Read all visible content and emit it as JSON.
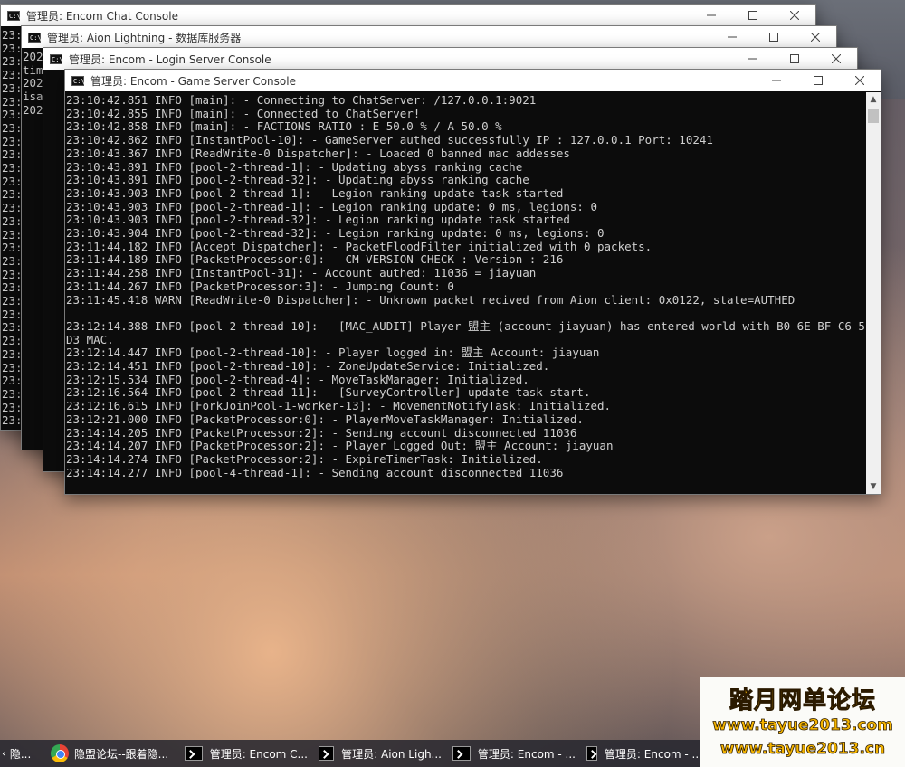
{
  "windows": [
    {
      "title": "管理员: Encom Chat Console",
      "lines": [
        "23:",
        "23:",
        "23:",
        "23:",
        "23:",
        "23:",
        "23:",
        "23:",
        "23:",
        "23:",
        "23:",
        "23:",
        "23:",
        "23:",
        "23:",
        "23:",
        "23:",
        "23:",
        "23:",
        "23:",
        "23:",
        "23:",
        "23:",
        "23:",
        "23:",
        "23:",
        "23:",
        "23:",
        "23:",
        "23:",
        "23:"
      ]
    },
    {
      "title": "管理员: Aion Lightning - 数据库服务器",
      "lines": [
        "202",
        "tim",
        "202",
        "isa",
        "202",
        "",
        "",
        "",
        "",
        "",
        "",
        "",
        "",
        "",
        "",
        "",
        "",
        "",
        "",
        "",
        "",
        "",
        "",
        "",
        "",
        "",
        "",
        "",
        "",
        "",
        "",
        "",
        ""
      ]
    },
    {
      "title": "管理员: Encom - Login Server Console",
      "lines": []
    },
    {
      "title": "管理员: Encom - Game Server Console",
      "lines": [
        "23:10:42.851 INFO [main]: - Connecting to ChatServer: /127.0.0.1:9021",
        "23:10:42.855 INFO [main]: - Connected to ChatServer!",
        "23:10:42.858 INFO [main]: - FACTIONS RATIO : E 50.0 % / A 50.0 %",
        "23:10:42.862 INFO [InstantPool-10]: - GameServer authed successfully IP : 127.0.0.1 Port: 10241",
        "23:10:43.367 INFO [ReadWrite-0 Dispatcher]: - Loaded 0 banned mac addesses",
        "23:10:43.891 INFO [pool-2-thread-1]: - Updating abyss ranking cache",
        "23:10:43.891 INFO [pool-2-thread-32]: - Updating abyss ranking cache",
        "23:10:43.903 INFO [pool-2-thread-1]: - Legion ranking update task started",
        "23:10:43.903 INFO [pool-2-thread-1]: - Legion ranking update: 0 ms, legions: 0",
        "23:10:43.903 INFO [pool-2-thread-32]: - Legion ranking update task started",
        "23:10:43.904 INFO [pool-2-thread-32]: - Legion ranking update: 0 ms, legions: 0",
        "23:11:44.182 INFO [Accept Dispatcher]: - PacketFloodFilter initialized with 0 packets.",
        "23:11:44.189 INFO [PacketProcessor:0]: - CM VERSION CHECK : Version : 216",
        "23:11:44.258 INFO [InstantPool-31]: - Account authed: 11036 = jiayuan",
        "23:11:44.267 INFO [PacketProcessor:3]: - Jumping Count: 0",
        "23:11:45.418 WARN [ReadWrite-0 Dispatcher]: - Unknown packet recived from Aion client: 0x0122, state=AUTHED",
        "",
        "23:12:14.388 INFO [pool-2-thread-10]: - [MAC_AUDIT] Player 盟主 (account jiayuan) has entered world with B0-6E-BF-C6-51-",
        "D3 MAC.",
        "23:12:14.447 INFO [pool-2-thread-10]: - Player logged in: 盟主 Account: jiayuan",
        "23:12:14.451 INFO [pool-2-thread-10]: - ZoneUpdateService: Initialized.",
        "23:12:15.534 INFO [pool-2-thread-4]: - MoveTaskManager: Initialized.",
        "23:12:16.564 INFO [pool-2-thread-11]: - [SurveyController] update task start.",
        "23:12:16.615 INFO [ForkJoinPool-1-worker-13]: - MovementNotifyTask: Initialized.",
        "23:12:21.000 INFO [PacketProcessor:0]: - PlayerMoveTaskManager: Initialized.",
        "23:14:14.205 INFO [PacketProcessor:2]: - Sending account disconnected 11036",
        "23:14:14.207 INFO [PacketProcessor:2]: - Player Logged Out: 盟主 Account: jiayuan",
        "23:14:14.274 INFO [PacketProcessor:2]: - ExpireTimerTask: Initialized.",
        "23:14:14.277 INFO [pool-4-thread-1]: - Sending account disconnected 11036"
      ]
    }
  ],
  "taskbar": {
    "items": [
      {
        "label": "隐...",
        "icon": "arrow-icon"
      },
      {
        "label": "隐盟论坛--跟着隐...",
        "icon": "chrome-icon"
      },
      {
        "label": "管理员: Encom C...",
        "icon": "cmd-icon"
      },
      {
        "label": "管理员: Aion Ligh...",
        "icon": "cmd-icon"
      },
      {
        "label": "管理员: Encom - ...",
        "icon": "cmd-icon"
      },
      {
        "label": "管理员: Encom - ...",
        "icon": "cmd-icon"
      }
    ]
  },
  "watermark": {
    "title": "踏月网单论坛",
    "url1": "www.tayue2013.com",
    "url2": "www.tayue2013.cn"
  },
  "colors": {
    "console_bg": "#0c0c0c",
    "console_text": "#cfcfcf",
    "titlebar_bg": "#ffffff",
    "watermark_text": "#f4b400"
  }
}
